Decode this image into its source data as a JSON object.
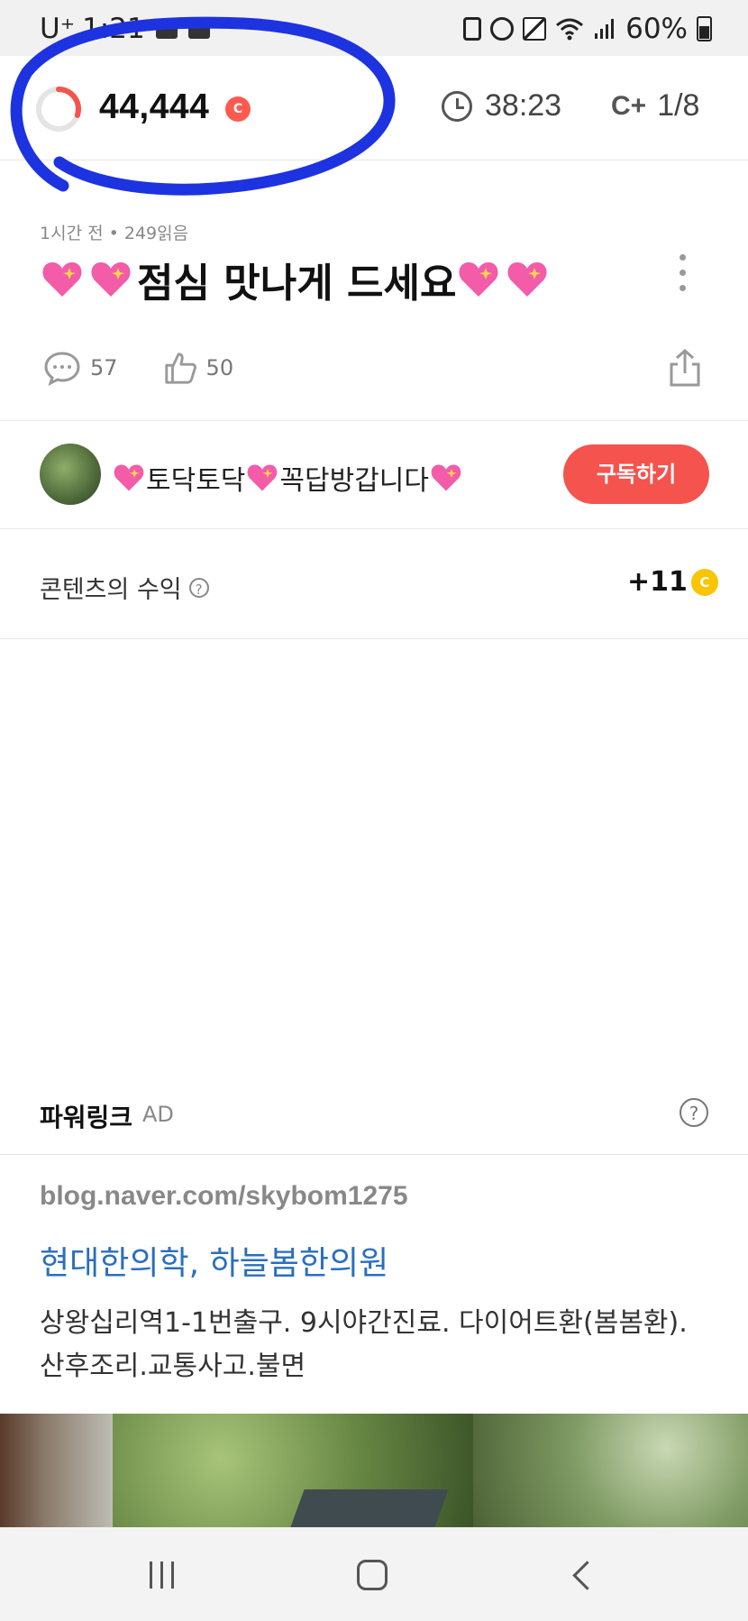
{
  "status_bar": {
    "carrier": "U⁺",
    "time": "1:21",
    "battery": "60%"
  },
  "top_bar": {
    "coin_count": "44,444",
    "coin_badge": "C",
    "progress_fraction": 0.3,
    "timer": "38:23",
    "page_indicator_icon": "C+",
    "page_indicator": "1/8"
  },
  "post": {
    "meta": "1시간 전 • 249읽음",
    "title": "점심 맛나게 드세요",
    "comment_count": "57",
    "like_count": "50"
  },
  "author": {
    "name_left": "토닥토닥",
    "name_right": "꼭답방갑니다",
    "subscribe_label": "구독하기"
  },
  "revenue": {
    "label": "콘텐츠의 수익",
    "help": "?",
    "value": "+11",
    "coin_symbol": "C"
  },
  "ad": {
    "section_label": "파워링크",
    "ad_tag": "AD",
    "help": "?",
    "url": "blog.naver.com/skybom1275",
    "title": "현대한의학, 하늘봄한의원",
    "description": "상왕십리역1-1번출구. 9시야간진료. 다이어트환(봄봄환). 산후조리.교통사고.불면"
  },
  "colors": {
    "accent_red": "#f5534d",
    "coin_gold": "#f9c400",
    "ad_link_blue": "#2a6fbd",
    "annotation_blue": "#1d33e0"
  },
  "icons": [
    "sparkling-heart-icon",
    "clock-icon",
    "comment-icon",
    "thumbs-up-icon",
    "share-icon",
    "help-icon",
    "coin-icon"
  ]
}
